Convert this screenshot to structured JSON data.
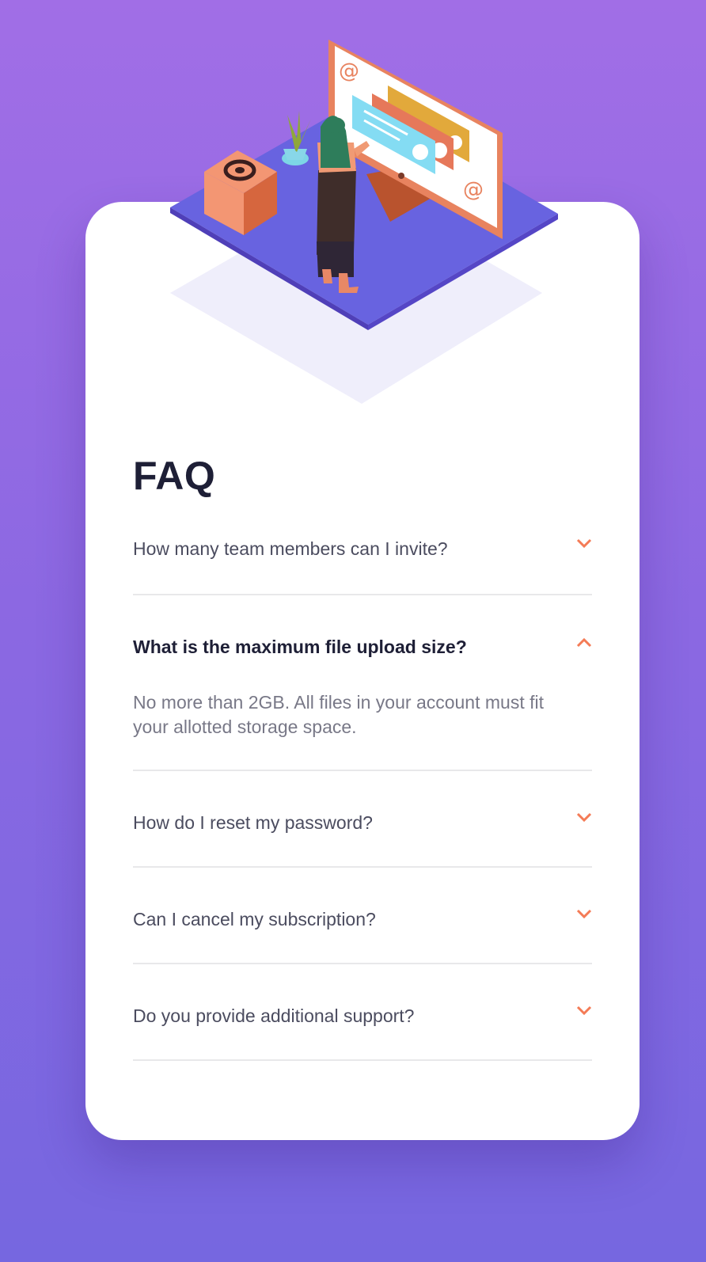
{
  "title": "FAQ",
  "faq": [
    {
      "question": "How many team members can I invite?",
      "answer": "",
      "open": false
    },
    {
      "question": "What is the maximum file upload size?",
      "answer": "No more than 2GB. All files in your account must fit your allotted storage space.",
      "open": true
    },
    {
      "question": "How do I reset my password?",
      "answer": "",
      "open": false
    },
    {
      "question": "Can I cancel my subscription?",
      "answer": "",
      "open": false
    },
    {
      "question": "Do you provide additional support?",
      "answer": "",
      "open": false
    }
  ],
  "colors": {
    "bg_top": "#A16EE6",
    "bg_bottom": "#7667E0",
    "accent": "#F47B56",
    "title": "#1E1F36",
    "text": "#4B4C5F",
    "muted": "#787887",
    "divider": "#E8E8EA"
  },
  "icons": {
    "collapsed": "chevron-down-icon",
    "expanded": "chevron-up-icon",
    "hero": "woman-online-illustration"
  }
}
